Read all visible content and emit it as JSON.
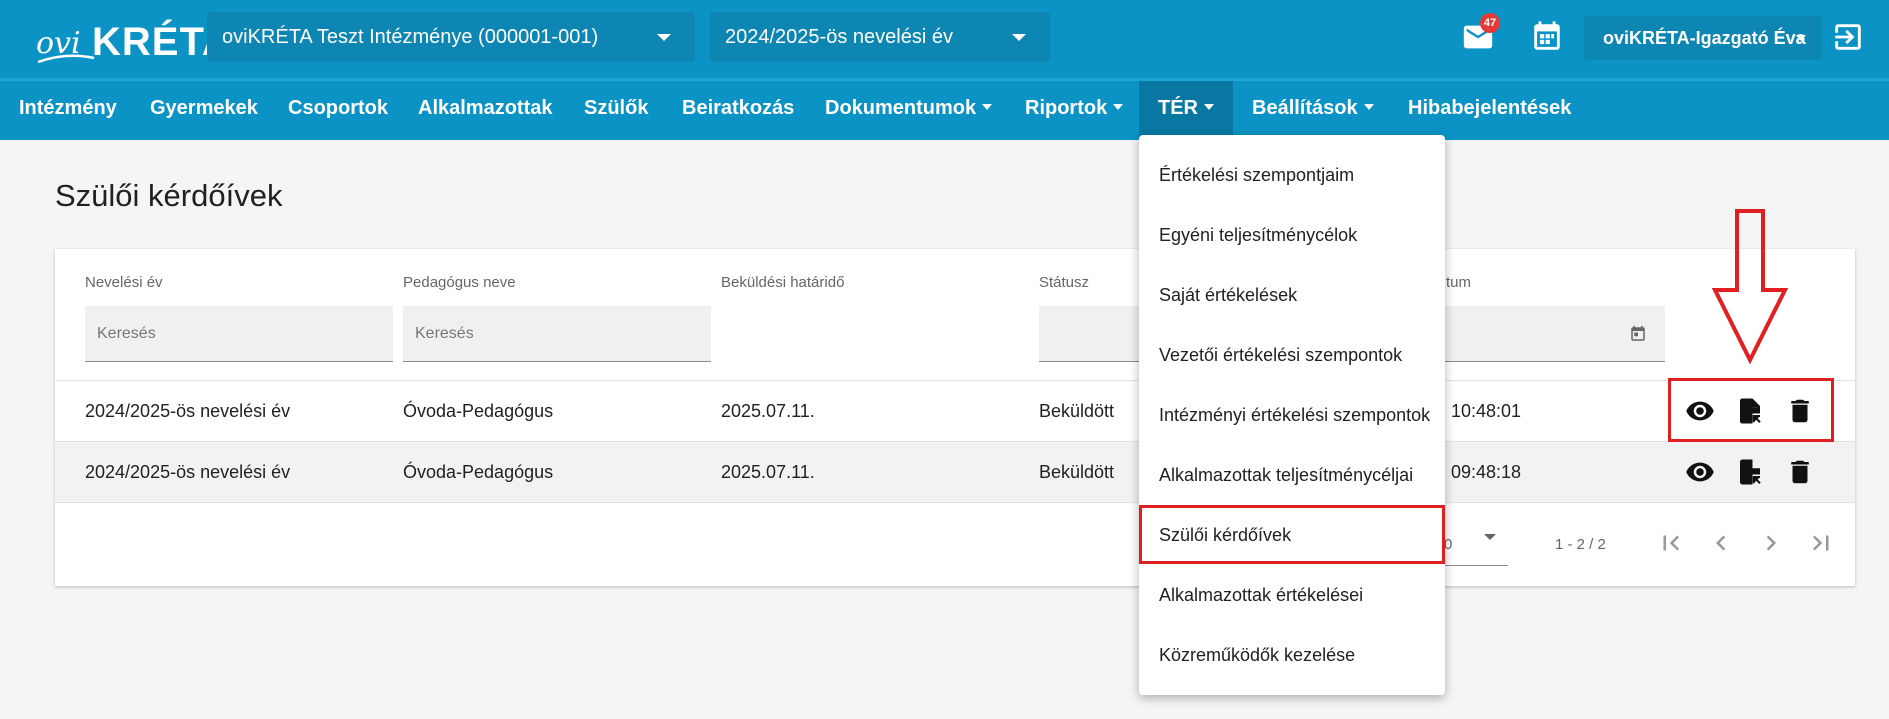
{
  "brand": {
    "prefix": "ovi",
    "name": "KRÉTA"
  },
  "header": {
    "institution_select": "oviKRÉTA Teszt Intézménye (000001-001)",
    "year_select": "2024/2025-ös nevelési év",
    "notification_count": "47",
    "user_menu": "oviKRÉTA-Igazgató Éva",
    "icons": [
      "mail-icon",
      "calendar-icon",
      "logout-icon"
    ]
  },
  "nav": {
    "items": [
      {
        "label": "Intézmény"
      },
      {
        "label": "Gyermekek"
      },
      {
        "label": "Csoportok"
      },
      {
        "label": "Alkalmazottak"
      },
      {
        "label": "Szülők"
      },
      {
        "label": "Beiratkozás"
      },
      {
        "label": "Dokumentumok"
      },
      {
        "label": "Riportok"
      },
      {
        "label": "TÉR"
      },
      {
        "label": "Beállítások"
      },
      {
        "label": "Hibabejelentések"
      }
    ],
    "active": "TÉR"
  },
  "page": {
    "title": "Szülői kérdőívek"
  },
  "table": {
    "columns": [
      "Nevelési év",
      "Pedagógus neve",
      "Beküldési határidő",
      "Státusz",
      "tum"
    ],
    "search_placeholder": "Keresés",
    "rows": [
      {
        "year": "2024/2025-ös nevelési év",
        "teacher": "Óvoda-Pedagógus",
        "deadline": "2025.07.11.",
        "status": "Beküldött",
        "date": ". 10:48:01"
      },
      {
        "year": "2024/2025-ös nevelési év",
        "teacher": "Óvoda-Pedagógus",
        "deadline": "2025.07.11.",
        "status": "Beküldött",
        "date": ". 09:48:18"
      }
    ],
    "row_actions": [
      "eye-icon",
      "file-export-icon",
      "delete-icon"
    ],
    "page_size_partial": "0",
    "range": "1 - 2 / 2"
  },
  "dropdown_menu": {
    "items": [
      "Értékelési szempontjaim",
      "Egyéni teljesítménycélok",
      "Saját értékelések",
      "Vezetői értékelési szempontok",
      "Intézményi értékelési szempontok",
      "Alkalmazottak teljesítménycéljai",
      "Szülői kérdőívek",
      "Alkalmazottak értékelései",
      "Közreműködők kezelése"
    ],
    "highlighted": "Szülői kérdőívek"
  },
  "annotation_color": "#e02020"
}
